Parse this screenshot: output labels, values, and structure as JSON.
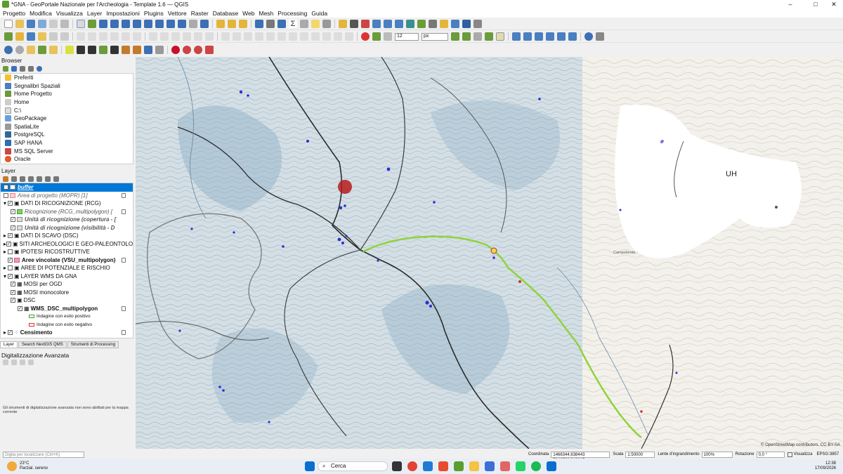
{
  "window": {
    "title": "*GNA - GeoPortale Nazionale per l'Archeologia - Template 1.6 — QGIS"
  },
  "menu": [
    "Progetto",
    "Modifica",
    "Visualizza",
    "Layer",
    "Impostazioni",
    "Plugins",
    "Vettore",
    "Raster",
    "Database",
    "Web",
    "Mesh",
    "Processing",
    "Guida"
  ],
  "snapping": {
    "tolerance": "12",
    "unit": "px"
  },
  "browser": {
    "title": "Browser",
    "items": [
      "Preferiti",
      "Segnalibri Spaziali",
      "Home Progetto",
      "Home",
      "C:\\",
      "GeoPackage",
      "SpatiaLite",
      "PostgreSQL",
      "SAP HANA",
      "MS SQL Server",
      "Oracle"
    ]
  },
  "layers": {
    "title": "Layer",
    "items": [
      {
        "label": "buffer",
        "style": "selected"
      },
      {
        "label": "Area di progetto (MOPR) [1]",
        "style": "italic"
      },
      {
        "label": "DATI DI RICOGNIZIONE (RCG)",
        "style": "normal"
      },
      {
        "label": "Ricognizione (RCG_multipolygon) [",
        "style": "italic"
      },
      {
        "label": "Unità di ricognizione (copertura - [",
        "style": "italic"
      },
      {
        "label": "Unità di ricognizione (visibilità - D",
        "style": "italic"
      },
      {
        "label": "DATI DI SCAVO (DSC)",
        "style": "normal"
      },
      {
        "label": "SITI ARCHEOLOGICI E GEO-PALEONTOLOG",
        "style": "normal"
      },
      {
        "label": "IPOTESI RICOSTRUTTIVE",
        "style": "normal"
      },
      {
        "label": "Aree vincolate (VSU_multipolygon)",
        "style": "bold"
      },
      {
        "label": "AREE DI POTENZIALE E RISCHIO",
        "style": "normal"
      },
      {
        "label": "LAYER WMS DA GNA",
        "style": "normal"
      },
      {
        "label": "MOSI per OGD",
        "style": "normal"
      },
      {
        "label": "MOSI monocolore",
        "style": "normal"
      },
      {
        "label": "DSC",
        "style": "normal"
      },
      {
        "label": "WMS_DSC_multipolygon",
        "style": "bold"
      },
      {
        "label": "Indagine con esito positivo",
        "style": "legend"
      },
      {
        "label": "Indagine con esito negativo",
        "style": "legend"
      },
      {
        "label": "Censimento",
        "style": "bold"
      }
    ]
  },
  "tabs": [
    "Layer",
    "Search NextGIS QMS",
    "Strumenti di Processing"
  ],
  "digitizing": {
    "title": "Digitalizzazione Avanzata",
    "message": "Gli strumenti di digitalizzazione avanzata non sono abilitati per la mappa corrente"
  },
  "map": {
    "label_uh": "UH",
    "attribution": "© OpenStreetMap contributors, CC-BY-SA",
    "place_label": "Campoloreto"
  },
  "status": {
    "locator_placeholder": "Digita per localizzare (Ctrl+K)",
    "coord_label": "Coordinata",
    "coord_value": "1466344,638443 5242503,940245",
    "scale_label": "Scala",
    "scale_value": "1:50000",
    "magnifier_label": "Lente d'ingrandimento",
    "magnifier_value": "100%",
    "rotation_label": "Rotazione",
    "rotation_value": "0,0 °",
    "render_label": "Visualizza",
    "crs": "EPSG:3857"
  },
  "taskbar": {
    "weather_temp": "23°C",
    "weather_desc": "Parzial. sereno",
    "search": "Cerca",
    "time": "12:38",
    "date": "17/09/2026"
  },
  "colors": {
    "route": "#8fd33a",
    "qgis": "#5a9e2f",
    "selected": "#0078d7"
  }
}
